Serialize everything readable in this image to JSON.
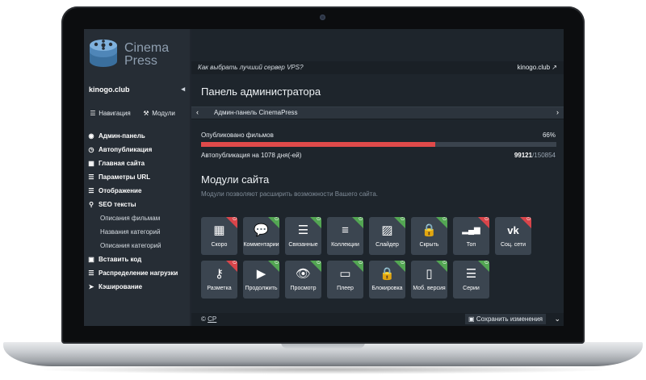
{
  "brand": {
    "name_line1": "Cinema",
    "name_line2": "Press"
  },
  "sidebar": {
    "site": "kinogo.club",
    "collapse_icon": "triangle-left-icon",
    "tabs": [
      {
        "icon": "menu-icon",
        "label": "Навигация"
      },
      {
        "icon": "wrench-icon",
        "label": "Модули"
      }
    ],
    "items": [
      {
        "icon": "dashboard-icon",
        "label": "Админ-панель",
        "sub": false
      },
      {
        "icon": "clock-icon",
        "label": "Автопубликация",
        "sub": false
      },
      {
        "icon": "grid-icon",
        "label": "Главная сайта",
        "sub": false
      },
      {
        "icon": "list-icon",
        "label": "Параметры URL",
        "sub": false
      },
      {
        "icon": "list-icon",
        "label": "Отображение",
        "sub": false
      },
      {
        "icon": "search-icon",
        "label": "SEO тексты",
        "sub": false
      },
      {
        "icon": "",
        "label": "Описания фильмам",
        "sub": true
      },
      {
        "icon": "",
        "label": "Названия категорий",
        "sub": true
      },
      {
        "icon": "",
        "label": "Описания категорий",
        "sub": true
      },
      {
        "icon": "code-icon",
        "label": "Вставить код",
        "sub": false
      },
      {
        "icon": "list-icon",
        "label": "Распределение нагрузки",
        "sub": false
      },
      {
        "icon": "rocket-icon",
        "label": "Кэширование",
        "sub": false
      }
    ]
  },
  "topbar": {
    "question": "Как выбрать лучший сервер VPS?",
    "site": "kinogo.club ↗"
  },
  "main": {
    "title": "Панель администратора",
    "breadcrumb": "Админ-панель CinemaPress",
    "prev_icon": "chevron-left-icon",
    "next_icon": "chevron-right-icon",
    "published_label": "Опубликовано фильмов",
    "published_percent": "66%",
    "progress": 0.66,
    "accent_color": "#e04a4a",
    "autopub_label": "Автопубликация на 1078 дня(-ей)",
    "count_done": "99121",
    "count_total": "/150854"
  },
  "modules": {
    "title": "Модули сайта",
    "description": "Модули позволяют расширить возможности Вашего сайта.",
    "tiles": [
      {
        "label": "Скоро",
        "icon": "calendar-icon",
        "glyph": "▦",
        "on": false
      },
      {
        "label": "Комментарии",
        "icon": "comments-icon",
        "glyph": "💬",
        "on": true
      },
      {
        "label": "Связанные",
        "icon": "list-alt-icon",
        "glyph": "☰",
        "on": true
      },
      {
        "label": "Коллекции",
        "icon": "indent-icon",
        "glyph": "≡",
        "on": true
      },
      {
        "label": "Слайдер",
        "icon": "picture-icon",
        "glyph": "▨",
        "on": true
      },
      {
        "label": "Скрыть",
        "icon": "lock-icon",
        "glyph": "🔒",
        "on": true
      },
      {
        "label": "Топ",
        "icon": "signal-icon",
        "glyph": "▂▄▆",
        "on": false
      },
      {
        "label": "Соц. сети",
        "icon": "vk-icon",
        "glyph": "vk",
        "on": false
      },
      {
        "label": "Разметка",
        "icon": "key-icon",
        "glyph": "⚷",
        "on": false
      },
      {
        "label": "Продолжить",
        "icon": "play-icon",
        "glyph": "▶",
        "on": true
      },
      {
        "label": "Просмотр",
        "icon": "eye-icon",
        "glyph": "👁",
        "on": true
      },
      {
        "label": "Плеер",
        "icon": "monitor-icon",
        "glyph": "▭",
        "on": true
      },
      {
        "label": "Блокировка",
        "icon": "lock-icon",
        "glyph": "🔒",
        "on": true
      },
      {
        "label": "Моб. версия",
        "icon": "mobile-icon",
        "glyph": "▯",
        "on": true
      },
      {
        "label": "Серии",
        "icon": "list-icon",
        "glyph": "☰",
        "on": true
      }
    ]
  },
  "footer": {
    "copyright_symbol": "©",
    "copyright_link": "CP",
    "save_icon": "floppy-icon",
    "save_label": "Сохранить изменения",
    "menu_icon": "chevron-down-icon"
  }
}
